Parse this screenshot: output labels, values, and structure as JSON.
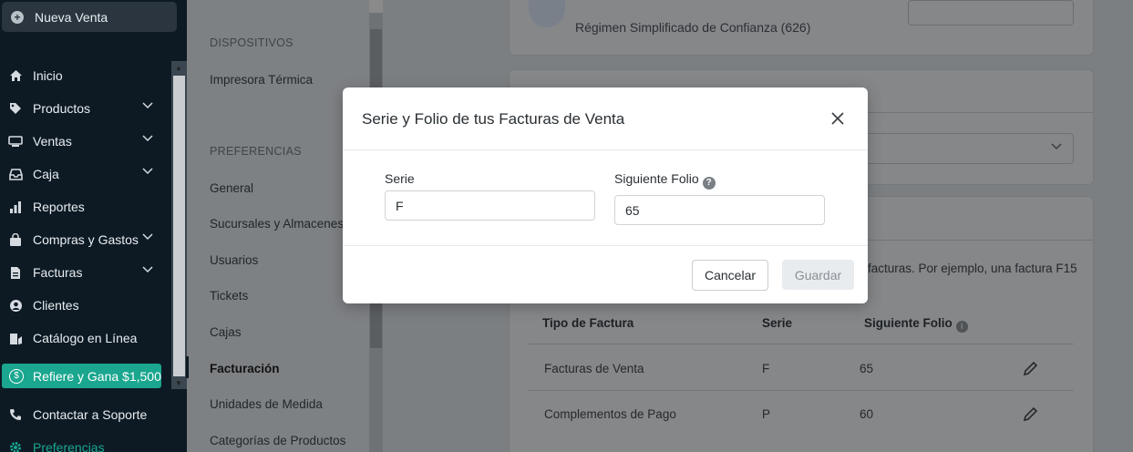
{
  "sidebar": {
    "new_sale": "Nueva Venta",
    "items": [
      {
        "label": "Inicio",
        "icon": "home-icon"
      },
      {
        "label": "Productos",
        "icon": "tag-icon"
      },
      {
        "label": "Ventas",
        "icon": "cash-register-icon"
      },
      {
        "label": "Caja",
        "icon": "inbox-icon"
      },
      {
        "label": "Reportes",
        "icon": "bar-chart-icon"
      },
      {
        "label": "Compras y Gastos",
        "icon": "shopping-bag-icon"
      },
      {
        "label": "Facturas",
        "icon": "document-icon"
      },
      {
        "label": "Clientes",
        "icon": "user-circle-icon"
      },
      {
        "label": "Catálogo en Línea",
        "icon": "catalog-icon"
      }
    ],
    "refer": "Refiere y Gana $1,500",
    "support": "Contactar a Soporte",
    "preferences": "Preferencias"
  },
  "settings_menu": {
    "section_devices": "DISPOSITIVOS",
    "thermal_printer": "Impresora Térmica",
    "section_preferences": "PREFERENCIAS",
    "links": [
      "General",
      "Sucursales y Almacenes",
      "Usuarios",
      "Tickets",
      "Cajas",
      "Facturación",
      "Unidades de Medida",
      "Categorías de Productos"
    ]
  },
  "background": {
    "regimen": "Régimen Simplificado de Confianza (626)",
    "invoice_hint": "facturas. Por ejemplo, una factura F15",
    "table": {
      "headers": [
        "Tipo de Factura",
        "Serie",
        "Siguiente Folio"
      ],
      "rows": [
        {
          "tipo": "Facturas de Venta",
          "serie": "F",
          "folio": "65"
        },
        {
          "tipo": "Complementos de Pago",
          "serie": "P",
          "folio": "60"
        }
      ]
    }
  },
  "modal": {
    "title": "Serie y Folio de tus Facturas de Venta",
    "serie_label": "Serie",
    "serie_value": "F",
    "folio_label": "Siguiente Folio",
    "folio_value": "65",
    "cancel_label": "Cancelar",
    "save_label": "Guardar"
  }
}
